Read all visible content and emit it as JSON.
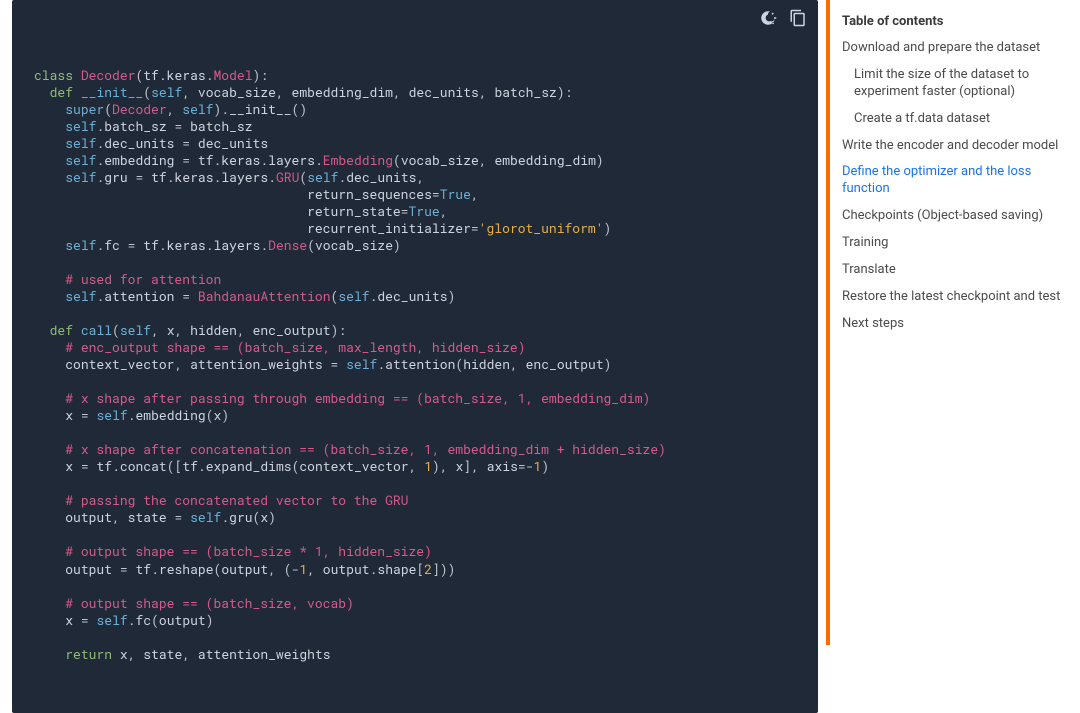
{
  "toc_title": "Table of contents",
  "toc": [
    {
      "label": "Download and prepare the dataset",
      "indent": false,
      "active": false
    },
    {
      "label": "Limit the size of the dataset to experiment faster (optional)",
      "indent": true,
      "active": false
    },
    {
      "label": "Create a tf.data dataset",
      "indent": true,
      "active": false
    },
    {
      "label": "Write the encoder and decoder model",
      "indent": false,
      "active": false
    },
    {
      "label": "Define the optimizer and the loss function",
      "indent": false,
      "active": true
    },
    {
      "label": "Checkpoints (Object-based saving)",
      "indent": false,
      "active": false
    },
    {
      "label": "Training",
      "indent": false,
      "active": false
    },
    {
      "label": "Translate",
      "indent": false,
      "active": false
    },
    {
      "label": "Restore the latest checkpoint and test",
      "indent": false,
      "active": false
    },
    {
      "label": "Next steps",
      "indent": false,
      "active": false
    }
  ],
  "code_lines_html": [
    "<span class='kw'>class</span> <span class='typ'>Decoder</span><span class='punc'>(</span><span class='ident'>tf</span><span class='punc'>.</span><span class='ident'>keras</span><span class='punc'>.</span><span class='typ'>Model</span><span class='punc'>):</span>",
    "  <span class='kw'>def</span> <span class='fn'>__init__</span><span class='punc'>(</span><span class='kwlt'>self</span><span class='punc'>,</span> <span class='ident'>vocab_size</span><span class='punc'>,</span> <span class='ident'>embedding_dim</span><span class='punc'>,</span> <span class='ident'>dec_units</span><span class='punc'>,</span> <span class='ident'>batch_sz</span><span class='punc'>):</span>",
    "    <span class='kwlt'>super</span><span class='punc'>(</span><span class='typ'>Decoder</span><span class='punc'>,</span> <span class='kwlt'>self</span><span class='punc'>).</span><span class='ident'>__init__</span><span class='punc'>()</span>",
    "    <span class='kwlt'>self</span><span class='punc'>.</span><span class='ident'>batch_sz</span> <span class='punc'>=</span> <span class='ident'>batch_sz</span>",
    "    <span class='kwlt'>self</span><span class='punc'>.</span><span class='ident'>dec_units</span> <span class='punc'>=</span> <span class='ident'>dec_units</span>",
    "    <span class='kwlt'>self</span><span class='punc'>.</span><span class='ident'>embedding</span> <span class='punc'>=</span> <span class='ident'>tf</span><span class='punc'>.</span><span class='ident'>keras</span><span class='punc'>.</span><span class='ident'>layers</span><span class='punc'>.</span><span class='typ'>Embedding</span><span class='punc'>(</span><span class='ident'>vocab_size</span><span class='punc'>,</span> <span class='ident'>embedding_dim</span><span class='punc'>)</span>",
    "    <span class='kwlt'>self</span><span class='punc'>.</span><span class='ident'>gru</span> <span class='punc'>=</span> <span class='ident'>tf</span><span class='punc'>.</span><span class='ident'>keras</span><span class='punc'>.</span><span class='ident'>layers</span><span class='punc'>.</span><span class='typ'>GRU</span><span class='punc'>(</span><span class='kwlt'>self</span><span class='punc'>.</span><span class='ident'>dec_units</span><span class='punc'>,</span>",
    "                                   <span class='ident'>return_sequences</span><span class='punc'>=</span><span class='kwlt'>True</span><span class='punc'>,</span>",
    "                                   <span class='ident'>return_state</span><span class='punc'>=</span><span class='kwlt'>True</span><span class='punc'>,</span>",
    "                                   <span class='ident'>recurrent_initializer</span><span class='punc'>=</span><span class='str'>'glorot_uniform'</span><span class='punc'>)</span>",
    "    <span class='kwlt'>self</span><span class='punc'>.</span><span class='ident'>fc</span> <span class='punc'>=</span> <span class='ident'>tf</span><span class='punc'>.</span><span class='ident'>keras</span><span class='punc'>.</span><span class='ident'>layers</span><span class='punc'>.</span><span class='typ'>Dense</span><span class='punc'>(</span><span class='ident'>vocab_size</span><span class='punc'>)</span>",
    "",
    "    <span class='cmt'># used for attention</span>",
    "    <span class='kwlt'>self</span><span class='punc'>.</span><span class='ident'>attention</span> <span class='punc'>=</span> <span class='typ'>BahdanauAttention</span><span class='punc'>(</span><span class='kwlt'>self</span><span class='punc'>.</span><span class='ident'>dec_units</span><span class='punc'>)</span>",
    "",
    "  <span class='kw'>def</span> <span class='fn'>call</span><span class='punc'>(</span><span class='kwlt'>self</span><span class='punc'>,</span> <span class='ident'>x</span><span class='punc'>,</span> <span class='ident'>hidden</span><span class='punc'>,</span> <span class='ident'>enc_output</span><span class='punc'>):</span>",
    "    <span class='cmt'># enc_output shape == (batch_size, max_length, hidden_size)</span>",
    "    <span class='ident'>context_vector</span><span class='punc'>,</span> <span class='ident'>attention_weights</span> <span class='punc'>=</span> <span class='kwlt'>self</span><span class='punc'>.</span><span class='ident'>attention</span><span class='punc'>(</span><span class='ident'>hidden</span><span class='punc'>,</span> <span class='ident'>enc_output</span><span class='punc'>)</span>",
    "",
    "    <span class='cmt'># x shape after passing through embedding == (batch_size, 1, embedding_dim)</span>",
    "    <span class='ident'>x</span> <span class='punc'>=</span> <span class='kwlt'>self</span><span class='punc'>.</span><span class='ident'>embedding</span><span class='punc'>(</span><span class='ident'>x</span><span class='punc'>)</span>",
    "",
    "    <span class='cmt'># x shape after concatenation == (batch_size, 1, embedding_dim + hidden_size)</span>",
    "    <span class='ident'>x</span> <span class='punc'>=</span> <span class='ident'>tf</span><span class='punc'>.</span><span class='ident'>concat</span><span class='punc'>([</span><span class='ident'>tf</span><span class='punc'>.</span><span class='ident'>expand_dims</span><span class='punc'>(</span><span class='ident'>context_vector</span><span class='punc'>,</span> <span class='num'>1</span><span class='punc'>),</span> <span class='ident'>x</span><span class='punc'>],</span> <span class='ident'>axis</span><span class='punc'>=-</span><span class='num'>1</span><span class='punc'>)</span>",
    "",
    "    <span class='cmt'># passing the concatenated vector to the GRU</span>",
    "    <span class='ident'>output</span><span class='punc'>,</span> <span class='ident'>state</span> <span class='punc'>=</span> <span class='kwlt'>self</span><span class='punc'>.</span><span class='ident'>gru</span><span class='punc'>(</span><span class='ident'>x</span><span class='punc'>)</span>",
    "",
    "    <span class='cmt'># output shape == (batch_size * 1, hidden_size)</span>",
    "    <span class='ident'>output</span> <span class='punc'>=</span> <span class='ident'>tf</span><span class='punc'>.</span><span class='ident'>reshape</span><span class='punc'>(</span><span class='ident'>output</span><span class='punc'>,</span> <span class='punc'>(-</span><span class='num'>1</span><span class='punc'>,</span> <span class='ident'>output</span><span class='punc'>.</span><span class='ident'>shape</span><span class='punc'>[</span><span class='num'>2</span><span class='punc'>]))</span>",
    "",
    "    <span class='cmt'># output shape == (batch_size, vocab)</span>",
    "    <span class='ident'>x</span> <span class='punc'>=</span> <span class='kwlt'>self</span><span class='punc'>.</span><span class='ident'>fc</span><span class='punc'>(</span><span class='ident'>output</span><span class='punc'>)</span>",
    "",
    "    <span class='kw'>return</span> <span class='ident'>x</span><span class='punc'>,</span> <span class='ident'>state</span><span class='punc'>,</span> <span class='ident'>attention_weights</span>"
  ]
}
